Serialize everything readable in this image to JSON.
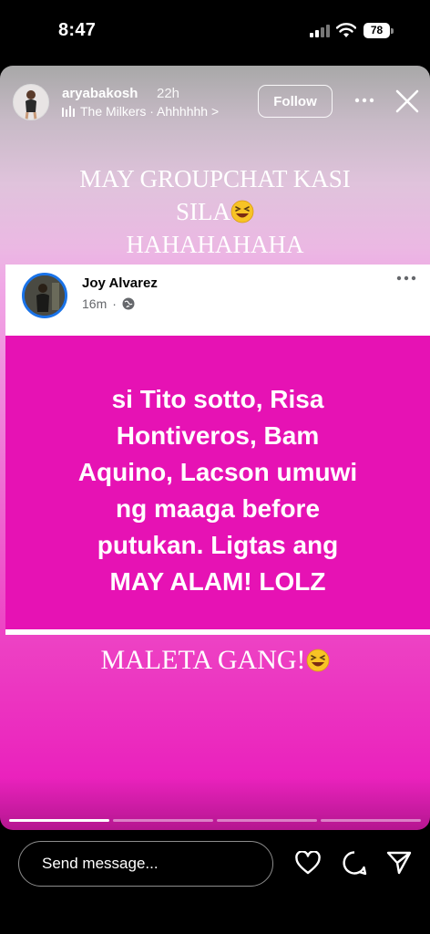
{
  "status_bar": {
    "time": "8:47",
    "battery": "78"
  },
  "story": {
    "username": "aryabakosh",
    "time_ago": "22h",
    "music": "The Milkers · Ahhhhhh >",
    "follow_label": "Follow",
    "caption_top_line1": "MAY GROUPCHAT KASI",
    "caption_top_line2": "SILA",
    "caption_top_line3": "HAHAHAHAHA",
    "caption_bottom": "MALETA GANG!",
    "progress_segments": 4,
    "progress_active": 1
  },
  "post": {
    "author": "Joy Alvarez",
    "time": "16m",
    "text_lines": [
      "si Tito sotto, Risa",
      "Hontiveros, Bam",
      "Aquino, Lacson umuwi",
      "ng maaga before",
      "putukan. Ligtas ang",
      "MAY ALAM! LOLZ"
    ],
    "background_color": "#e612b4"
  },
  "bottom_bar": {
    "message_placeholder": "Send message..."
  },
  "icons": [
    "signal-icon",
    "wifi-icon",
    "battery-icon",
    "music-icon",
    "more-icon",
    "close-icon",
    "globe-icon",
    "heart-icon",
    "chat-icon",
    "send-icon",
    "laughing-emoji-icon"
  ]
}
